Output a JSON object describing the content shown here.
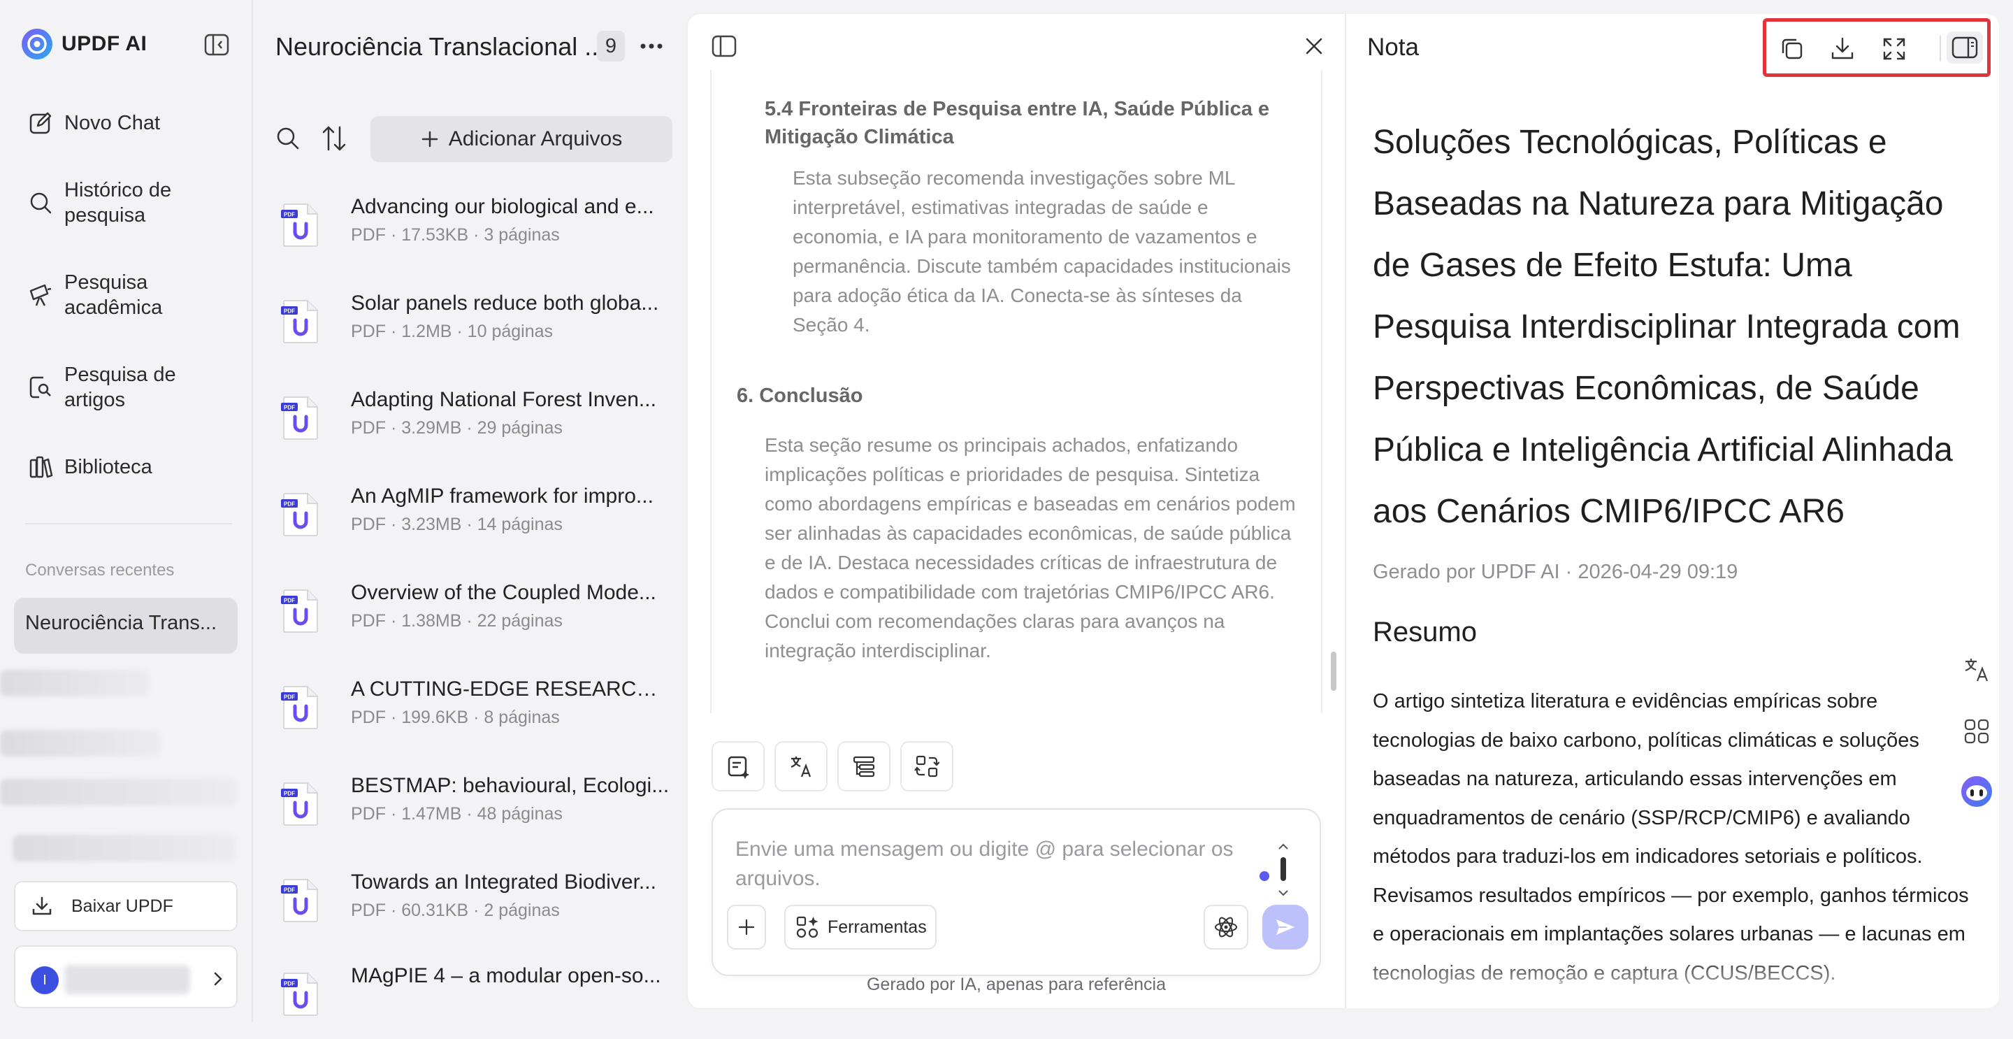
{
  "brand": {
    "name": "UPDF AI"
  },
  "sidebar": {
    "nav": [
      {
        "label": "Novo Chat",
        "icon": "new-chat-icon"
      },
      {
        "label": "Histórico de\npesquisa",
        "icon": "search-history-icon"
      },
      {
        "label": "Pesquisa\nacadêmica",
        "icon": "academic-search-icon"
      },
      {
        "label": "Pesquisa de\nartigos",
        "icon": "article-search-icon"
      },
      {
        "label": "Biblioteca",
        "icon": "library-icon"
      }
    ],
    "recent_title": "Conversas recentes",
    "recent_active": "Neurociência Trans...",
    "download_label": "Baixar UPDF",
    "avatar_initial": "I"
  },
  "files": {
    "folder_title": "Neurociência Translacional ...",
    "count": "9",
    "add_label": "Adicionar Arquivos",
    "items": [
      {
        "name": "Advancing our biological and e...",
        "meta": "PDF · 17.53KB · 3 páginas"
      },
      {
        "name": "Solar panels reduce both globa...",
        "meta": "PDF · 1.2MB · 10 páginas"
      },
      {
        "name": "Adapting National Forest Inven...",
        "meta": "PDF · 3.29MB · 29 páginas"
      },
      {
        "name": "An AgMIP framework for impro...",
        "meta": "PDF · 3.23MB · 14 páginas"
      },
      {
        "name": "Overview of the Coupled Mode...",
        "meta": "PDF · 1.38MB · 22 páginas"
      },
      {
        "name": "A CUTTING-EDGE RESEARCH O...",
        "meta": "PDF · 199.6KB · 8 páginas"
      },
      {
        "name": "BESTMAP: behavioural, Ecologi...",
        "meta": "PDF · 1.47MB · 48 páginas"
      },
      {
        "name": "Towards an Integrated Biodiver...",
        "meta": "PDF · 60.31KB · 2 páginas"
      },
      {
        "name": "MAgPIE 4 – a modular open-so...",
        "meta": ""
      }
    ]
  },
  "chat": {
    "sec54_title": "5.4 Fronteiras de Pesquisa entre IA, Saúde Pública e Mitigação Climática",
    "sec54_body": "Esta subseção recomenda investigações sobre ML interpretável, estimativas integradas de saúde e economia, e IA para monitoramento de vazamentos e permanência. Discute também capacidades institucionais para adoção ética da IA. Conecta-se às sínteses da Seção 4.",
    "sec6_title": "6. Conclusão",
    "sec6_body": "Esta seção resume os principais achados, enfatizando implicações políticas e prioridades de pesquisa. Sintetiza como abordagens empíricas e baseadas em cenários podem ser alinhadas às capacidades econômicas, de saúde pública e de IA. Destaca necessidades críticas de infraestrutura de dados e compatibilidade com trajetórias CMIP6/IPCC AR6. Conclui com recomendações claras para avanços na integração interdisciplinar.",
    "input_placeholder": "Envie uma mensagem ou digite @ para selecionar os arquivos.",
    "tools_label": "Ferramentas",
    "disclaimer": "Gerado por IA, apenas para referência"
  },
  "note": {
    "title": "Nota",
    "heading": "Soluções Tecnológicas, Políticas e Baseadas na Natureza para Mitigação de Gases de Efeito Estufa: Uma Pesquisa Interdisciplinar Integrada com Perspectivas Econômicas, de Saúde Pública e Inteligência Artificial Alinhada aos Cenários CMIP6/IPCC AR6",
    "generated": "Gerado por UPDF AI · 2026-04-29 09:19",
    "summary_title": "Resumo",
    "summary_body": "O artigo sintetiza literatura e evidências empíricas sobre tecnologias de baixo carbono, políticas climáticas e soluções baseadas na natureza, articulando essas intervenções em enquadramentos de cenário (SSP/RCP/CMIP6) e avaliando métodos para traduzi-los em indicadores setoriais e políticos. Revisamos resultados empíricos — por exemplo, ganhos térmicos e operacionais em implantações solares urbanas — e lacunas em tecnologias de remoção e captura (CCUS/BECCS)."
  },
  "colors": {
    "accent": "#5a5af0",
    "highlight_border": "#e0353b",
    "send_button": "#bcc0fb"
  }
}
